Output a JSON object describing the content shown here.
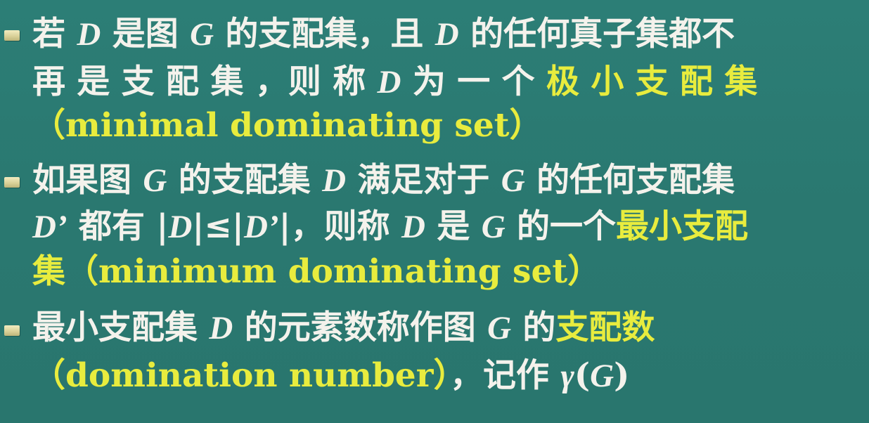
{
  "bullets": [
    {
      "lines": [
        [
          {
            "t": "若 ",
            "s": "w"
          },
          {
            "t": "D",
            "s": "wi"
          },
          {
            "t": " 是图 ",
            "s": "w"
          },
          {
            "t": "G",
            "s": "wi"
          },
          {
            "t": " 的支配集，且 ",
            "s": "w"
          },
          {
            "t": "D",
            "s": "wi"
          },
          {
            "t": " 的任何真子集都不",
            "s": "w"
          }
        ],
        [
          {
            "t": "再 是 支 配 集 ，则 称 ",
            "s": "w"
          },
          {
            "t": "D",
            "s": "wi"
          },
          {
            "t": " 为 一 个 ",
            "s": "w"
          },
          {
            "t": "极 小 支 配 集",
            "s": "y"
          }
        ],
        [
          {
            "t": "（minimal dominating set）",
            "s": "y"
          }
        ]
      ]
    },
    {
      "lines": [
        [
          {
            "t": "如果图 ",
            "s": "w"
          },
          {
            "t": "G",
            "s": "wi"
          },
          {
            "t": " 的支配集 ",
            "s": "w"
          },
          {
            "t": "D",
            "s": "wi"
          },
          {
            "t": " 满足对于 ",
            "s": "w"
          },
          {
            "t": "G",
            "s": "wi"
          },
          {
            "t": " 的任何支配集",
            "s": "w"
          }
        ],
        [
          {
            "t": "D’",
            "s": "wi"
          },
          {
            "t": " 都有 |",
            "s": "w"
          },
          {
            "t": "D",
            "s": "wi"
          },
          {
            "t": "|≤|",
            "s": "w"
          },
          {
            "t": "D’",
            "s": "wi"
          },
          {
            "t": "|，则称 ",
            "s": "w"
          },
          {
            "t": "D",
            "s": "wi"
          },
          {
            "t": " 是 ",
            "s": "w"
          },
          {
            "t": "G",
            "s": "wi"
          },
          {
            "t": " 的一个",
            "s": "w"
          },
          {
            "t": "最小支配",
            "s": "y"
          }
        ],
        [
          {
            "t": "集（minimum dominating set）",
            "s": "y"
          }
        ]
      ]
    },
    {
      "lines": [
        [
          {
            "t": "最小支配集  ",
            "s": "w"
          },
          {
            "t": "D",
            "s": "wi"
          },
          {
            "t": "  的元素数称作图  ",
            "s": "w"
          },
          {
            "t": "G",
            "s": "wi"
          },
          {
            "t": "  的",
            "s": "w"
          },
          {
            "t": "支配数",
            "s": "y"
          }
        ],
        [
          {
            "t": "（domination number）",
            "s": "y"
          },
          {
            "t": "，记作 ",
            "s": "w"
          },
          {
            "t": "γ",
            "s": "wi"
          },
          {
            "t": "(",
            "s": "w"
          },
          {
            "t": "G",
            "s": "wi"
          },
          {
            "t": ")",
            "s": "w"
          }
        ]
      ]
    }
  ],
  "colors": {
    "background": "#2a7a72",
    "text": "#f4f2ec",
    "highlight": "#e8ec3e",
    "bullet": "#e6dfae"
  }
}
